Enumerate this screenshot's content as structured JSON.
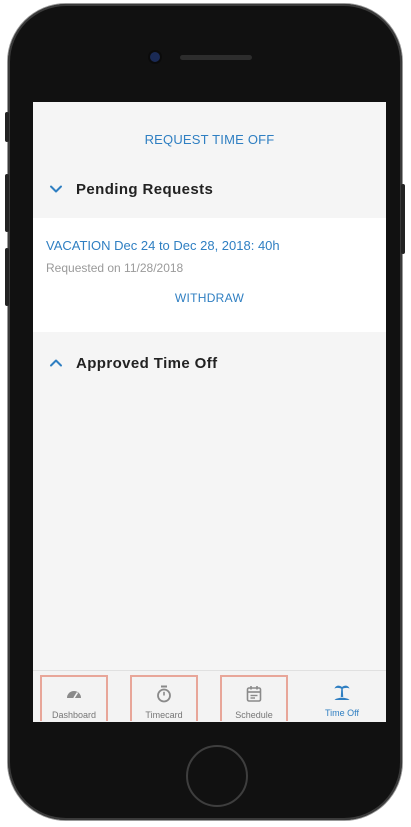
{
  "header": {
    "request_time_off_label": "REQUEST TIME OFF"
  },
  "pending": {
    "title": "Pending Requests",
    "requests": [
      {
        "title": "VACATION Dec 24 to Dec 28, 2018: 40h",
        "requested": "Requested on 11/28/2018",
        "action_label": "WITHDRAW"
      }
    ]
  },
  "approved": {
    "title": "Approved Time Off"
  },
  "tabbar": {
    "tabs": [
      {
        "label": "Dashboard",
        "icon": "gauge-icon"
      },
      {
        "label": "Timecard",
        "icon": "stopwatch-icon"
      },
      {
        "label": "Schedule",
        "icon": "calendar-icon"
      },
      {
        "label": "Time Off",
        "icon": "palm-tree-icon",
        "active": true
      }
    ]
  },
  "colors": {
    "accent": "#2f7fc2",
    "highlight_outline": "#e8a699",
    "screen_bg": "#f5f5f5"
  }
}
